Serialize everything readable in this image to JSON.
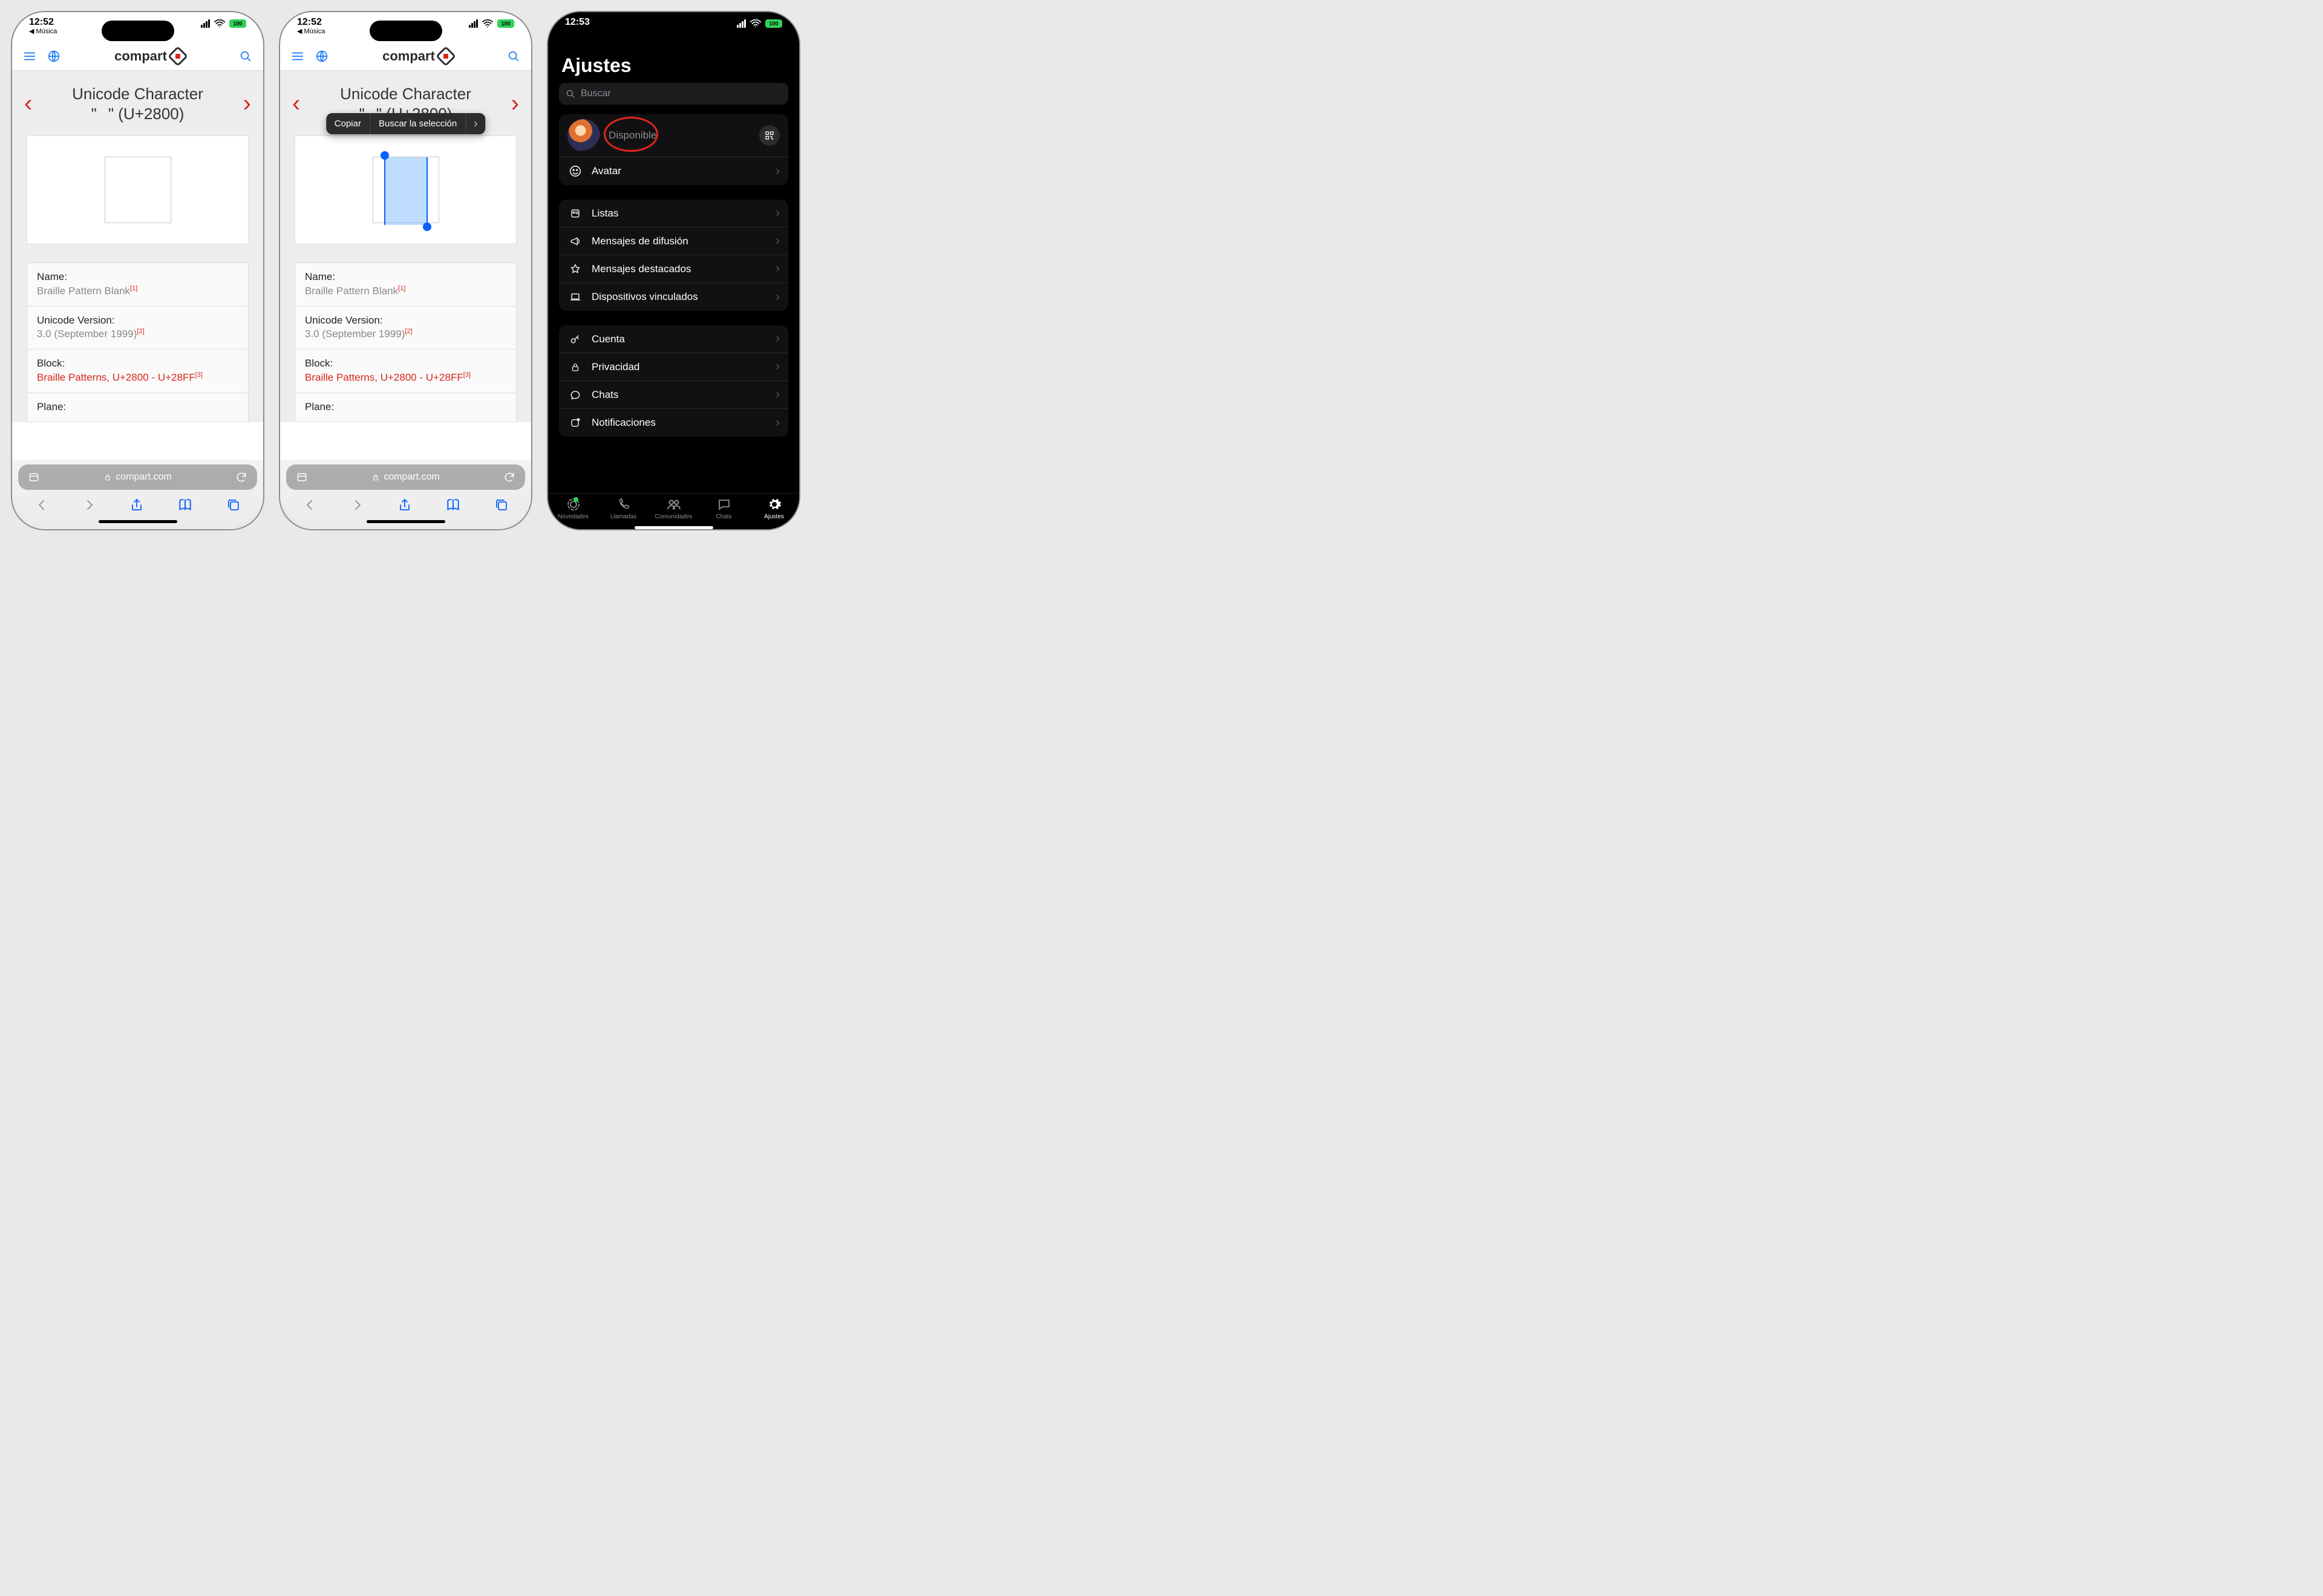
{
  "status_light": {
    "time": "12:52",
    "back_app": "Música",
    "battery": "100"
  },
  "status_dark": {
    "time": "12:53",
    "battery": "100"
  },
  "brand": "compart",
  "page_title_l1": "Unicode Character",
  "page_title_l2": "\"⠀\" (U+2800)",
  "ctx": {
    "copy": "Copiar",
    "search": "Buscar la selección"
  },
  "char_info": {
    "name_label": "Name:",
    "name_value": "Braille Pattern Blank",
    "name_ref": "[1]",
    "ver_label": "Unicode Version:",
    "ver_value": "3.0 (September 1999)",
    "ver_ref": "[2]",
    "block_label": "Block:",
    "block_value": "Braille Patterns, U+2800 - U+28FF",
    "block_ref": "[3]",
    "plane_label": "Plane:"
  },
  "url_domain": "compart.com",
  "wa": {
    "title": "Ajustes",
    "search_placeholder": "Buscar",
    "profile_status": "Disponible",
    "avatar_row": "Avatar",
    "list1": [
      "Listas",
      "Mensajes de difusión",
      "Mensajes destacados",
      "Dispositivos vinculados"
    ],
    "list2": [
      "Cuenta",
      "Privacidad",
      "Chats",
      "Notificaciones"
    ],
    "tabs": [
      "Novedades",
      "Llamadas",
      "Comunidades",
      "Chats",
      "Ajustes"
    ]
  }
}
